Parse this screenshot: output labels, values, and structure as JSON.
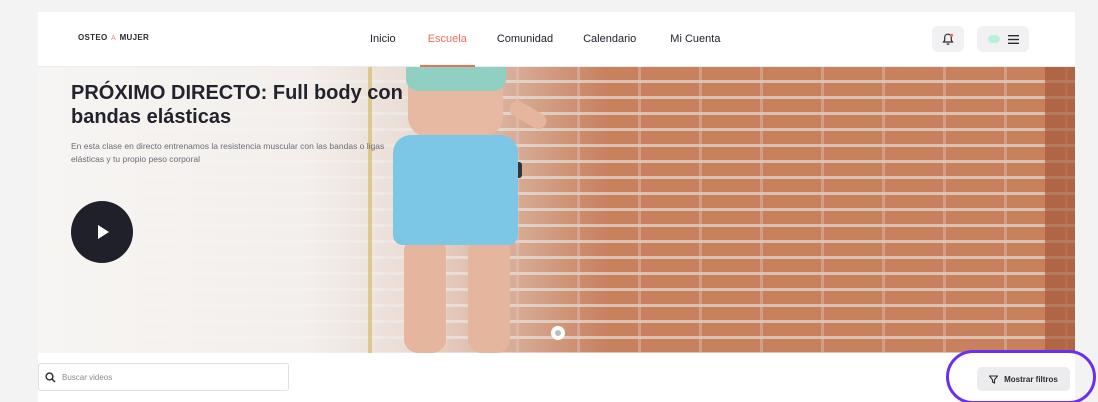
{
  "header": {
    "logo_left": "OSTEO",
    "logo_mid": "A",
    "logo_right": "MUJER",
    "nav": [
      {
        "label": "Inicio",
        "active": false
      },
      {
        "label": "Escuela",
        "active": true
      },
      {
        "label": "Comunidad",
        "active": false
      },
      {
        "label": "Calendario",
        "active": false
      },
      {
        "label": "Mi Cuenta",
        "active": false
      }
    ],
    "icons": {
      "notifications": "bell-icon",
      "menu": "hamburger-icon"
    }
  },
  "hero": {
    "title": "PRÓXIMO DIRECTO: Full body con bandas elásticas",
    "description": "En esta clase en directo entrenamos la resistencia muscular con las bandas o ligas elásticas y tu propio peso corporal",
    "play_icon": "play-icon"
  },
  "search": {
    "placeholder": "Buscar videos",
    "value": ""
  },
  "filters": {
    "label": "Mostrar filtros",
    "icon": "funnel-icon"
  },
  "colors": {
    "accent": "#ef6f55",
    "highlight": "#6b2ff0",
    "dark": "#1f2029"
  }
}
